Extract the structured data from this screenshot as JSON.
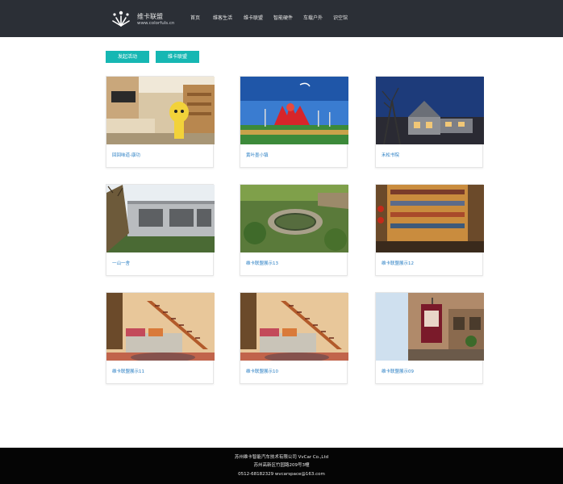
{
  "header": {
    "brand_name": "维卡联盟",
    "brand_url": "www.colorfuls.cn",
    "nav": [
      "首页",
      "维客生活",
      "维卡联盟",
      "智能硬件",
      "车载户外",
      "识空馆"
    ]
  },
  "actions": {
    "launch_activity": "发起活动",
    "alliance": "维卡联盟"
  },
  "cards": [
    {
      "caption": "回回味道-康功"
    },
    {
      "caption": "黄叶墨小镇"
    },
    {
      "caption": "禾松书院"
    },
    {
      "caption": "一山一舍"
    },
    {
      "caption": "维卡联盟展示13"
    },
    {
      "caption": "维卡联盟展示12"
    },
    {
      "caption": "维卡联盟展示11"
    },
    {
      "caption": "维卡联盟展示10"
    },
    {
      "caption": "维卡联盟展示09"
    }
  ],
  "footer": {
    "company": "苏州维卡智能汽车技术有限公司 VvCar Co.,Ltd",
    "address": "苏州高新区竹园路209号3幢",
    "contact": "0512-68182329    wvcarspace@163.com"
  },
  "colors": {
    "header_bg": "#2b2f36",
    "accent": "#16b7b3",
    "caption_link": "#2a7fc4",
    "footer_bg": "#050505"
  }
}
